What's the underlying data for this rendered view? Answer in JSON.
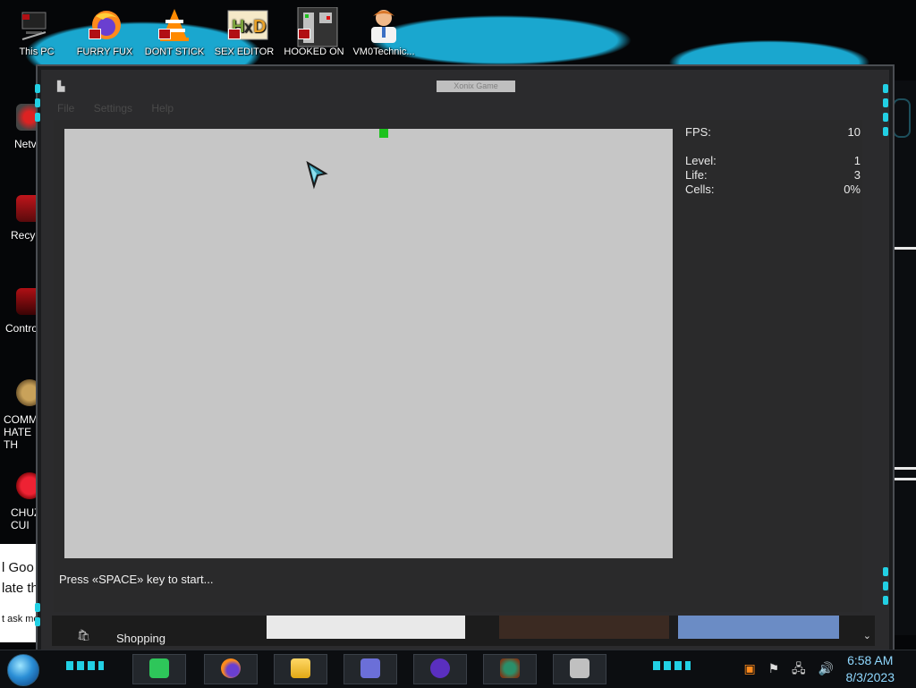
{
  "desktop_icons": [
    {
      "label": "This PC",
      "icon": "pc-icon"
    },
    {
      "label": "FURRY FUX",
      "icon": "firefox-icon"
    },
    {
      "label": "DONT STICK",
      "icon": "vlc-icon"
    },
    {
      "label": "SEX EDITOR",
      "icon": "hxd-icon"
    },
    {
      "label": "HOOKED ON",
      "icon": "game-app-icon"
    },
    {
      "label": "VM0Technic...",
      "icon": "doctor-icon"
    }
  ],
  "left_icons": [
    {
      "label": "Netv",
      "icon": "network-icon"
    },
    {
      "label": "Recycl",
      "icon": "recycle-bin-icon"
    },
    {
      "label": "Control",
      "icon": "control-panel-icon"
    },
    {
      "label": "COMMU HATE TH",
      "icon": "moneybag-icon"
    },
    {
      "label": "CHUZ CUI",
      "icon": "red-character-icon"
    }
  ],
  "left_chat": [
    "l Goo",
    "late th",
    "t ask me"
  ],
  "window": {
    "title": "Xonix Game",
    "menu": [
      "File",
      "Settings",
      "Help"
    ],
    "stats": [
      {
        "label": "FPS:",
        "value": "10"
      },
      {
        "label": "Level:",
        "value": "1"
      },
      {
        "label": "Life:",
        "value": "3"
      },
      {
        "label": "Cells:",
        "value": "0%"
      }
    ],
    "status": "Press «SPACE» key to start..."
  },
  "below_window": {
    "shopping_label": "Shopping"
  },
  "taskbar": {
    "items": [
      "notes-app",
      "firefox",
      "file-explorer",
      "id-card-app",
      "mask-app",
      "character-app",
      "xonix-game"
    ],
    "time": "6:58 AM",
    "date": "8/3/2023"
  },
  "colors": {
    "accent": "#22d0e4",
    "field": "#c6c6c6",
    "panel": "#2a2a2b",
    "marker": "#1ec21e"
  }
}
